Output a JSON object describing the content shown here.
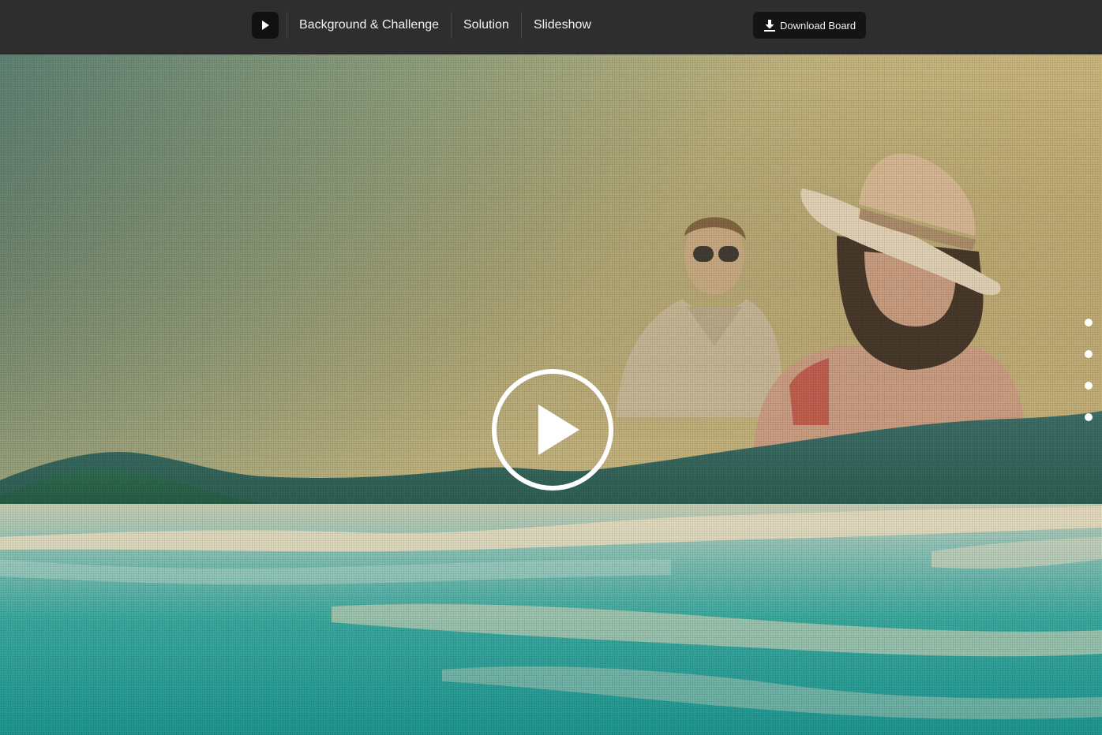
{
  "topbar": {
    "play_icon": "play-icon",
    "nav": [
      {
        "label": "Background & Challenge"
      },
      {
        "label": "Solution"
      },
      {
        "label": "Slideshow"
      }
    ],
    "download": {
      "label": "Download Board",
      "icon": "download-icon"
    }
  },
  "hero": {
    "play_icon": "play-circle-icon",
    "slide_count": 4
  },
  "colors": {
    "topbar_bg": "#2e2e2e",
    "button_bg": "#141414",
    "text": "#f2f2f2",
    "sky_top": "#b9b27e",
    "sea": "#2aa59a"
  }
}
